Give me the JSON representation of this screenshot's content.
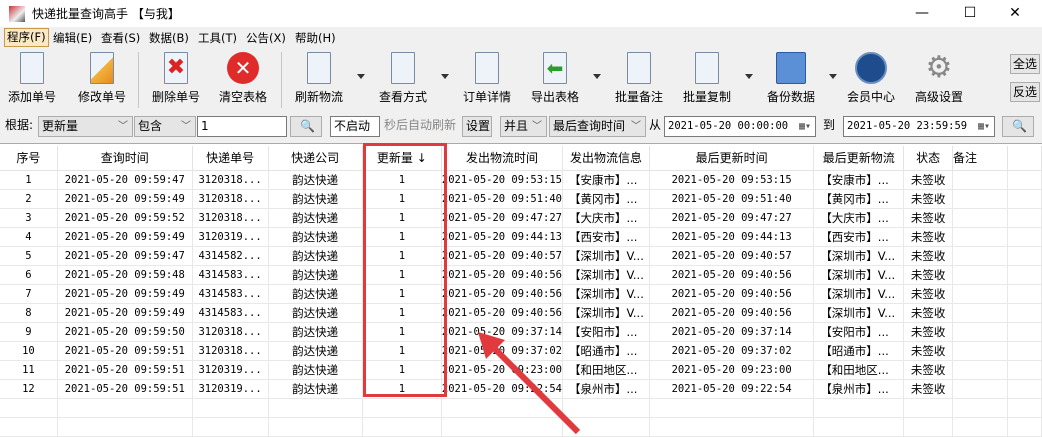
{
  "window": {
    "title": "快递批量查询高手 【与我】",
    "minimize": "—",
    "maximize": "☐",
    "close": "✕"
  },
  "menu": [
    "程序(F)",
    "编辑(E)",
    "查看(S)",
    "数据(B)",
    "工具(T)",
    "公告(X)",
    "帮助(H)"
  ],
  "toolbar": {
    "add": "添加单号",
    "edit": "修改单号",
    "delete": "删除单号",
    "clear": "清空表格",
    "refresh": "刷新物流",
    "view": "查看方式",
    "detail": "订单详情",
    "export": "导出表格",
    "batch_note": "批量备注",
    "batch_copy": "批量复制",
    "backup": "备份数据",
    "member": "会员中心",
    "advanced": "高级设置",
    "select_all": "全选",
    "invert": "反选"
  },
  "filter": {
    "by_label": "根据:",
    "field": "更新量",
    "match": "包含",
    "value": "1",
    "auto_refresh": "不启动",
    "auto_refresh_label": "秒后自动刷新",
    "settings": "设置",
    "logic": "并且",
    "time_field": "最后查询时间",
    "from_label": "从",
    "from": "2021-05-20 00:00:00",
    "to_label": "到",
    "to": "2021-05-20 23:59:59"
  },
  "table": {
    "headers": [
      "序号",
      "查询时间",
      "快递单号",
      "快递公司",
      "更新量 ↓",
      "发出物流时间",
      "发出物流信息",
      "最后更新时间",
      "最后更新物流",
      "状态",
      "备注"
    ],
    "rows": [
      [
        "1",
        "2021-05-20 09:59:47",
        "3120318...",
        "韵达快递",
        "1",
        "2021-05-20 09:53:15",
        "【安康市】...",
        "2021-05-20 09:53:15",
        "【安康市】...",
        "未签收",
        ""
      ],
      [
        "2",
        "2021-05-20 09:59:49",
        "3120318...",
        "韵达快递",
        "1",
        "2021-05-20 09:51:40",
        "【黄冈市】...",
        "2021-05-20 09:51:40",
        "【黄冈市】...",
        "未签收",
        ""
      ],
      [
        "3",
        "2021-05-20 09:59:52",
        "3120318...",
        "韵达快递",
        "1",
        "2021-05-20 09:47:27",
        "【大庆市】...",
        "2021-05-20 09:47:27",
        "【大庆市】...",
        "未签收",
        ""
      ],
      [
        "4",
        "2021-05-20 09:59:49",
        "3120319...",
        "韵达快递",
        "1",
        "2021-05-20 09:44:13",
        "【西安市】...",
        "2021-05-20 09:44:13",
        "【西安市】...",
        "未签收",
        ""
      ],
      [
        "5",
        "2021-05-20 09:59:47",
        "4314582...",
        "韵达快递",
        "1",
        "2021-05-20 09:40:57",
        "【深圳市】V...",
        "2021-05-20 09:40:57",
        "【深圳市】V...",
        "未签收",
        ""
      ],
      [
        "6",
        "2021-05-20 09:59:48",
        "4314583...",
        "韵达快递",
        "1",
        "2021-05-20 09:40:56",
        "【深圳市】V...",
        "2021-05-20 09:40:56",
        "【深圳市】V...",
        "未签收",
        ""
      ],
      [
        "7",
        "2021-05-20 09:59:49",
        "4314583...",
        "韵达快递",
        "1",
        "2021-05-20 09:40:56",
        "【深圳市】V...",
        "2021-05-20 09:40:56",
        "【深圳市】V...",
        "未签收",
        ""
      ],
      [
        "8",
        "2021-05-20 09:59:49",
        "4314583...",
        "韵达快递",
        "1",
        "2021-05-20 09:40:56",
        "【深圳市】V...",
        "2021-05-20 09:40:56",
        "【深圳市】V...",
        "未签收",
        ""
      ],
      [
        "9",
        "2021-05-20 09:59:50",
        "3120318...",
        "韵达快递",
        "1",
        "2021-05-20 09:37:14",
        "【安阳市】...",
        "2021-05-20 09:37:14",
        "【安阳市】...",
        "未签收",
        ""
      ],
      [
        "10",
        "2021-05-20 09:59:51",
        "3120318...",
        "韵达快递",
        "1",
        "2021-05-20 09:37:02",
        "【昭通市】...",
        "2021-05-20 09:37:02",
        "【昭通市】...",
        "未签收",
        ""
      ],
      [
        "11",
        "2021-05-20 09:59:51",
        "3120319...",
        "韵达快递",
        "1",
        "2021-05-20 09:23:00",
        "【和田地区...",
        "2021-05-20 09:23:00",
        "【和田地区...",
        "未签收",
        ""
      ],
      [
        "12",
        "2021-05-20 09:59:51",
        "3120319...",
        "韵达快递",
        "1",
        "2021-05-20 09:22:54",
        "【泉州市】...",
        "2021-05-20 09:22:54",
        "【泉州市】...",
        "未签收",
        ""
      ]
    ]
  },
  "colors": {
    "highlight": "#e03a3e"
  }
}
